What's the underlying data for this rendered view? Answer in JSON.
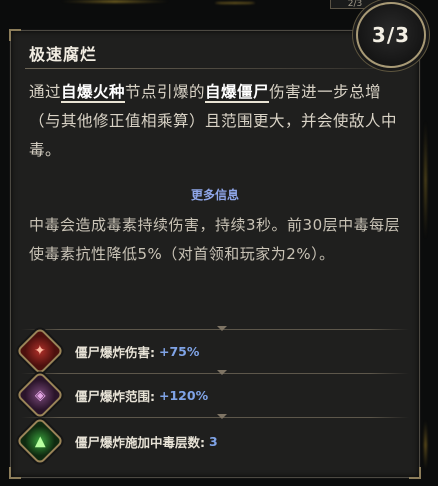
{
  "top_tab": "2/3",
  "tooltip": {
    "title": "极速腐烂",
    "rank": "3/3",
    "description": {
      "p1": "通过",
      "kw1": "自爆火种",
      "p2": "节点引爆的",
      "kw2": "自爆僵尸",
      "p3": "伤害进一步总增（与其他修正值相乘算）且范围更大，并会使敌人中毒。"
    },
    "more_info": "更多信息",
    "detail": "中毒会造成毒素持续伤害，持续3秒。前30层中毒每层使毒素抗性降低5%（对首领和玩家为2%）。",
    "stats": [
      {
        "label": "僵尸爆炸伤害:",
        "value": "+75%",
        "icon": "explosion-damage-icon"
      },
      {
        "label": "僵尸爆炸范围:",
        "value": "+120%",
        "icon": "explosion-area-icon"
      },
      {
        "label": "僵尸爆炸施加中毒层数:",
        "value": "3",
        "icon": "poison-stack-icon"
      }
    ]
  },
  "colors": {
    "value_blue": "#7fa3e6",
    "more_info_blue": "#8fa6e8",
    "panel_bg": "#1f1f1e",
    "gold_border": "#a89a76"
  }
}
